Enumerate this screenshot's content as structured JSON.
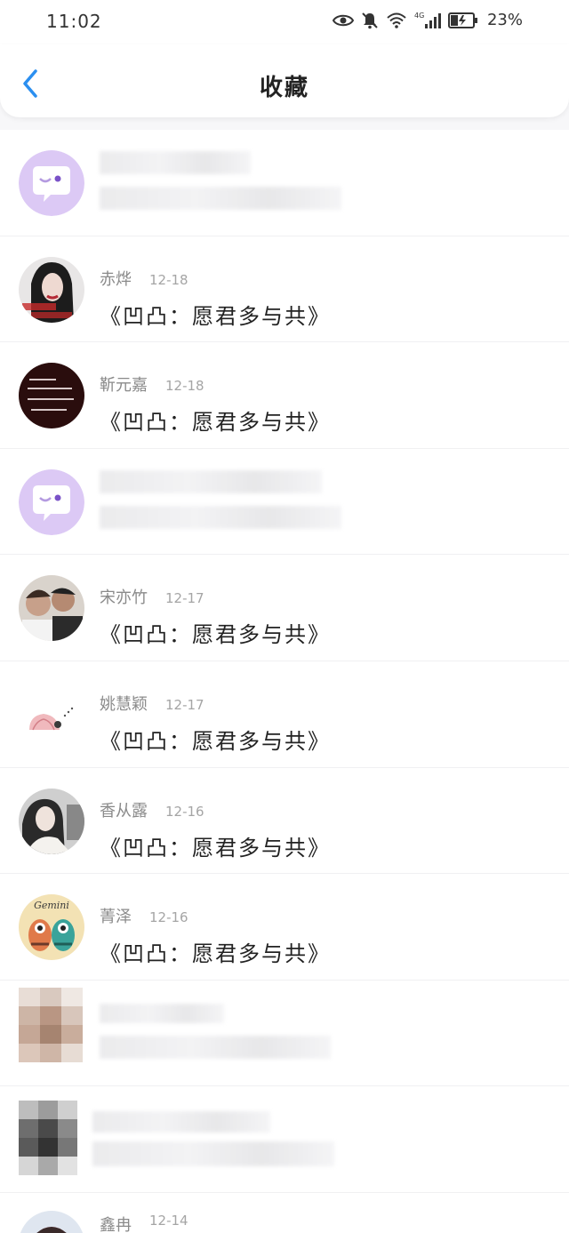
{
  "status_bar": {
    "time": "11:02",
    "battery": "23%",
    "network": "4G",
    "icons": [
      "eye-icon",
      "bell-mute-icon",
      "wifi-icon",
      "signal-icon",
      "battery-icon"
    ]
  },
  "header": {
    "title": "收藏",
    "back_icon": "chevron-left-icon",
    "accent_color": "#2b8ff0"
  },
  "items": [
    {
      "name": "",
      "date": "",
      "title": "",
      "obscured": true,
      "avatar": "bubble-icon"
    },
    {
      "name": "赤烨",
      "date": "12-18",
      "title": "《凹凸：愿君多与共》",
      "avatar": "portrait"
    },
    {
      "name": "靳元嘉",
      "date": "12-18",
      "title": "《凹凸：愿君多与共》",
      "avatar": "dark-text"
    },
    {
      "name": "",
      "date": "",
      "title": "",
      "obscured": true,
      "avatar": "bubble-icon"
    },
    {
      "name": "宋亦竹",
      "date": "12-17",
      "title": "《凹凸：愿君多与共》",
      "avatar": "photo"
    },
    {
      "name": "姚慧颖",
      "date": "12-17",
      "title": "《凹凸：愿君多与共》",
      "avatar": "sticker"
    },
    {
      "name": "香从露",
      "date": "12-16",
      "title": "《凹凸：愿君多与共》",
      "avatar": "photo-bw"
    },
    {
      "name": "菁泽",
      "date": "12-16",
      "title": "《凹凸：愿君多与共》",
      "avatar": "gemini"
    },
    {
      "name": "",
      "date": "",
      "title": "",
      "obscured": true,
      "avatar": "pixelated"
    },
    {
      "name": "",
      "date": "",
      "title": "",
      "obscured": true,
      "avatar": "pixelated-dark"
    },
    {
      "name": "鑫冉",
      "date": "12-14",
      "title": "",
      "avatar": "photo-pink",
      "partial": true
    }
  ],
  "avatar_labels": {
    "gemini": "Gemini"
  },
  "bubble_color": "#d9c8f3"
}
